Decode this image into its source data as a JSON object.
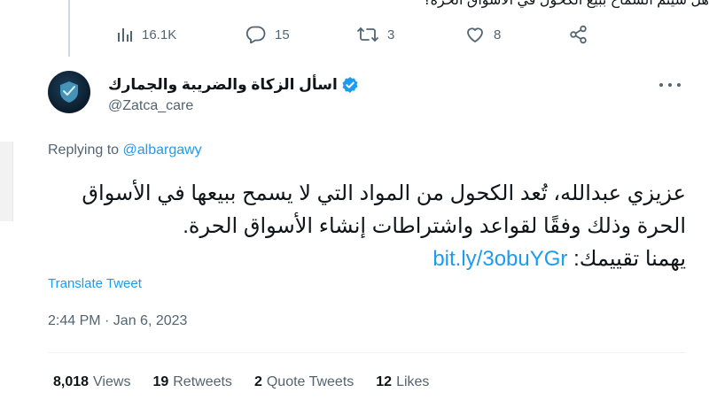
{
  "previous_tweet": {
    "clipped_text": "هل سيتم السماح ببيع الكحول في الأسواق الحرة؟",
    "actions": {
      "views": "16.1K",
      "replies": "15",
      "retweets": "3",
      "likes": "8"
    }
  },
  "tweet": {
    "display_name": "اسأل الزكاة والضريبة والجمارك",
    "handle": "@Zatca_care",
    "replying_prefix": "Replying to",
    "replying_to": "@albargawy",
    "body_lines": [
      "عزيزي عبدالله، تُعد الكحول من المواد التي لا يسمح ببيعها في الأسواق",
      "الحرة وذلك وفقًا لقواعد واشتراطات إنشاء الأسواق الحرة."
    ],
    "body_last_prefix": "يهمنا تقييمك:",
    "body_link": "bit.ly/3obuYGr",
    "translate_label": "Translate Tweet",
    "timestamp": "2:44 PM · Jan 6, 2023",
    "stats": {
      "views_count": "8,018",
      "views_label": "Views",
      "retweets_count": "19",
      "retweets_label": "Retweets",
      "quotes_count": "2",
      "quotes_label": "Quote Tweets",
      "likes_count": "12",
      "likes_label": "Likes"
    }
  },
  "colors": {
    "accent": "#1d9bf0",
    "secondary_text": "#536471",
    "primary_text": "#0f1419"
  },
  "icons": [
    "views-icon",
    "reply-icon",
    "retweet-icon",
    "like-icon",
    "share-icon",
    "verified-badge-icon",
    "more-options-icon"
  ]
}
